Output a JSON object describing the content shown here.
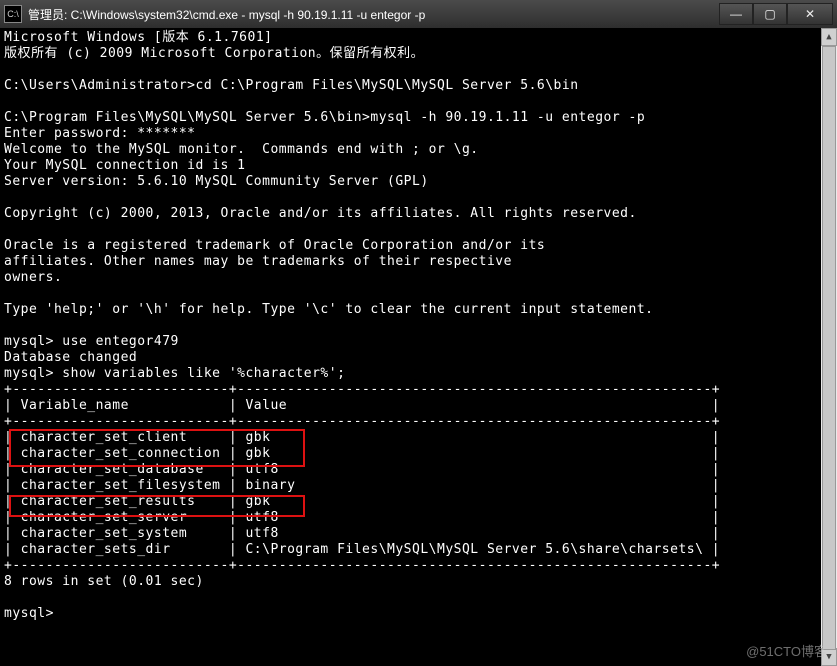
{
  "titlebar": {
    "icon_label": "C:\\",
    "text": "管理员: C:\\Windows\\system32\\cmd.exe - mysql  -h 90.19.1.11 -u entegor -p",
    "min": "—",
    "max": "▢",
    "close": "✕"
  },
  "scrollbar": {
    "up": "▲",
    "down": "▼"
  },
  "watermark": "@51CTO博客",
  "lines": {
    "l01": "Microsoft Windows [版本 6.1.7601]",
    "l02": "版权所有 (c) 2009 Microsoft Corporation。保留所有权利。",
    "l03": "",
    "l04": "C:\\Users\\Administrator>cd C:\\Program Files\\MySQL\\MySQL Server 5.6\\bin",
    "l05": "",
    "l06": "C:\\Program Files\\MySQL\\MySQL Server 5.6\\bin>mysql -h 90.19.1.11 -u entegor -p",
    "l07": "Enter password: *******",
    "l08": "Welcome to the MySQL monitor.  Commands end with ; or \\g.",
    "l09": "Your MySQL connection id is 1",
    "l10": "Server version: 5.6.10 MySQL Community Server (GPL)",
    "l11": "",
    "l12": "Copyright (c) 2000, 2013, Oracle and/or its affiliates. All rights reserved.",
    "l13": "",
    "l14": "Oracle is a registered trademark of Oracle Corporation and/or its",
    "l15": "affiliates. Other names may be trademarks of their respective",
    "l16": "owners.",
    "l17": "",
    "l18": "Type 'help;' or '\\h' for help. Type '\\c' to clear the current input statement.",
    "l19": "",
    "l20": "mysql> use entegor479",
    "l21": "Database changed",
    "l22": "mysql> show variables like '%character%';",
    "l23": "+--------------------------+---------------------------------------------------------+",
    "l24": "| Variable_name            | Value                                                   |",
    "l25": "+--------------------------+---------------------------------------------------------+",
    "l26": "| character_set_client     | gbk                                                     |",
    "l27": "| character_set_connection | gbk                                                     |",
    "l28": "| character_set_database   | utf8                                                    |",
    "l29": "| character_set_filesystem | binary                                                  |",
    "l30": "| character_set_results    | gbk                                                     |",
    "l31": "| character_set_server     | utf8                                                    |",
    "l32": "| character_set_system     | utf8                                                    |",
    "l33": "| character_sets_dir       | C:\\Program Files\\MySQL\\MySQL Server 5.6\\share\\charsets\\ |",
    "l34": "+--------------------------+---------------------------------------------------------+",
    "l35": "8 rows in set (0.01 sec)",
    "l36": "",
    "l37": "mysql>"
  },
  "chart_data": {
    "type": "table",
    "title": "show variables like '%character%';",
    "columns": [
      "Variable_name",
      "Value"
    ],
    "rows": [
      [
        "character_set_client",
        "gbk"
      ],
      [
        "character_set_connection",
        "gbk"
      ],
      [
        "character_set_database",
        "utf8"
      ],
      [
        "character_set_filesystem",
        "binary"
      ],
      [
        "character_set_results",
        "gbk"
      ],
      [
        "character_set_server",
        "utf8"
      ],
      [
        "character_set_system",
        "utf8"
      ],
      [
        "character_sets_dir",
        "C:\\Program Files\\MySQL\\MySQL Server 5.6\\share\\charsets\\"
      ]
    ],
    "footer": "8 rows in set (0.01 sec)"
  }
}
